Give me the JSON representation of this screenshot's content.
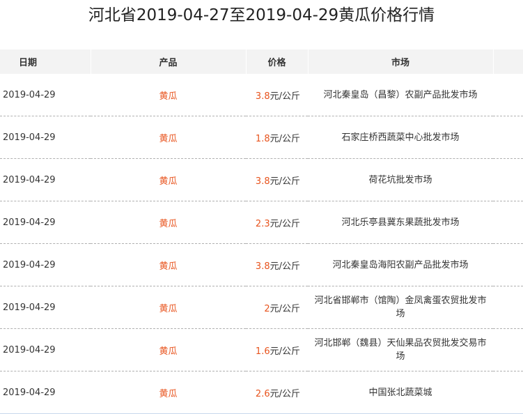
{
  "title": "河北省2019-04-27至2019-04-29黄瓜价格行情",
  "columns": {
    "date": "日期",
    "product": "产品",
    "price": "价格",
    "market": "市场"
  },
  "rows": [
    {
      "date": "2019-04-29",
      "product": "黄瓜",
      "price": "3.8",
      "unit": "元/公斤",
      "market": "河北秦皇岛（昌黎）农副产品批发市场"
    },
    {
      "date": "2019-04-29",
      "product": "黄瓜",
      "price": "1.8",
      "unit": "元/公斤",
      "market": "石家庄桥西蔬菜中心批发市场"
    },
    {
      "date": "2019-04-29",
      "product": "黄瓜",
      "price": "3.8",
      "unit": "元/公斤",
      "market": "荷花坑批发市场"
    },
    {
      "date": "2019-04-29",
      "product": "黄瓜",
      "price": "2.3",
      "unit": "元/公斤",
      "market": "河北乐亭县冀东果蔬批发市场"
    },
    {
      "date": "2019-04-29",
      "product": "黄瓜",
      "price": "3.8",
      "unit": "元/公斤",
      "market": "河北秦皇岛海阳农副产品批发市场"
    },
    {
      "date": "2019-04-29",
      "product": "黄瓜",
      "price": "2",
      "unit": "元/公斤",
      "market": "河北省邯郸市（馆陶）金凤禽蛋农贸批发市场"
    },
    {
      "date": "2019-04-29",
      "product": "黄瓜",
      "price": "1.6",
      "unit": "元/公斤",
      "market": "河北邯郸（魏县）天仙果品农贸批发交易市场"
    },
    {
      "date": "2019-04-29",
      "product": "黄瓜",
      "price": "2.6",
      "unit": "元/公斤",
      "market": "中国张北蔬菜城"
    }
  ],
  "colors": {
    "accent": "#e8541e",
    "header_bg": "#f3f3f3"
  }
}
